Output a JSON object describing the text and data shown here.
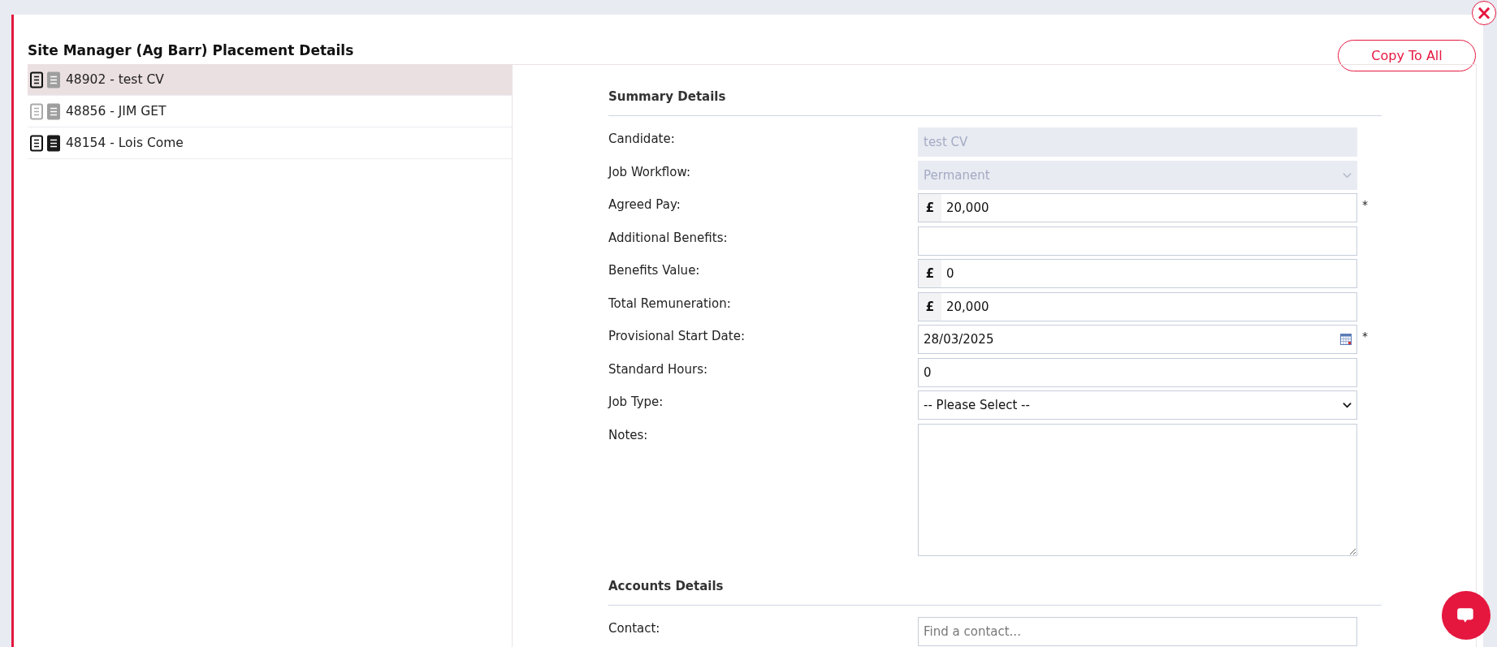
{
  "dialog": {
    "title": "Site Manager (Ag Barr) Placement Details",
    "close": "×",
    "copy_button": "Copy To All"
  },
  "placements": [
    {
      "label": "48902 - test CV",
      "selected": true,
      "doc_active": true,
      "filled_doc_active": false
    },
    {
      "label": "48856 - JIM GET",
      "selected": false,
      "doc_active": false,
      "filled_doc_active": false
    },
    {
      "label": "48154 - Lois Come",
      "selected": false,
      "doc_active": true,
      "filled_doc_active": true
    }
  ],
  "sections": [
    {
      "heading": "Summary Details",
      "fields": [
        {
          "label": "Candidate:",
          "kind": "text",
          "value": "test CV",
          "disabled": true,
          "required": false
        },
        {
          "label": "Job Workflow:",
          "kind": "select",
          "value": "Permanent",
          "disabled": true,
          "required": false
        },
        {
          "label": "Agreed Pay:",
          "kind": "currency",
          "prefix": "£",
          "value": "20,000",
          "required": true
        },
        {
          "label": "Additional Benefits:",
          "kind": "text",
          "disabled": false,
          "required": false
        },
        {
          "label": "Benefits Value:",
          "kind": "currency",
          "prefix": "£",
          "value": "0",
          "required": false
        },
        {
          "label": "Total Remuneration:",
          "kind": "currency",
          "prefix": "£",
          "value": "20,000",
          "required": false
        },
        {
          "label": "Provisional Start Date:",
          "kind": "date",
          "value": "28/03/2025",
          "required": true
        },
        {
          "label": "Standard Hours:",
          "kind": "text",
          "value": "0",
          "disabled": false,
          "required": false
        },
        {
          "label": "Job Type:",
          "kind": "select",
          "value": "-- Please Select --",
          "disabled": false,
          "required": false
        },
        {
          "label": "Notes:",
          "kind": "textarea",
          "required": false
        }
      ]
    },
    {
      "heading": "Accounts Details",
      "fields": [
        {
          "label": "Contact:",
          "kind": "text",
          "placeholder": "Find a contact...",
          "disabled": false,
          "required": false
        }
      ]
    }
  ],
  "required_mark": "*"
}
